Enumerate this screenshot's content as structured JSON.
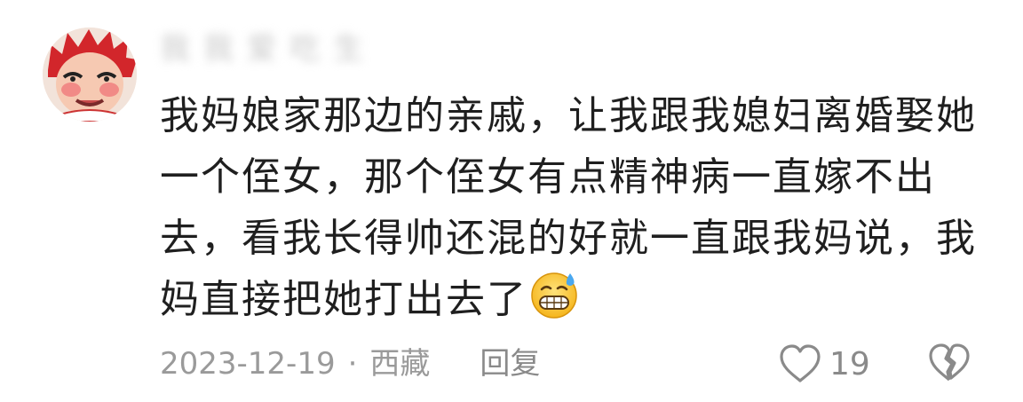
{
  "comment": {
    "username": "我 我 爱 吃 生",
    "text": "我妈娘家那边的亲戚，让我跟我媳妇离婚娶她一个侄女，那个侄女有点精神病一直嫁不出去，看我长得帅还混的好就一直跟我妈说，我妈直接把她打出去了",
    "emoji_icon": "grimacing-sweat-emoji-icon",
    "date": "2023-12-19",
    "separator": "·",
    "location": "西藏",
    "reply_label": "回复",
    "like_count": "19"
  },
  "colors": {
    "text": "#1f1f1f",
    "meta": "#9a9a9a",
    "icon": "#8a8a8a"
  }
}
